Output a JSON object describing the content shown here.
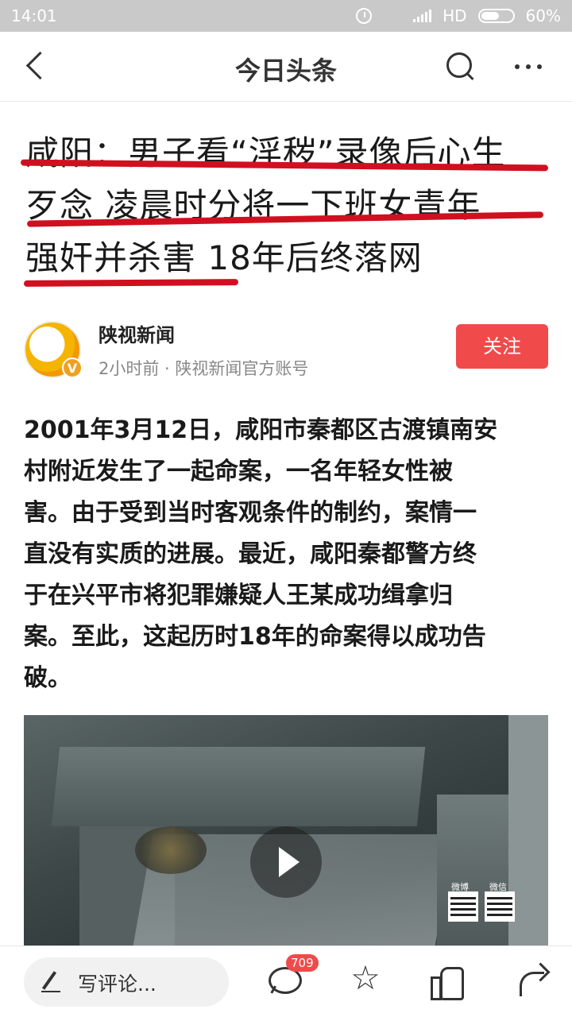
{
  "status_bar": {
    "time": "14:01",
    "network": "HD",
    "battery": "60%",
    "battery_level": 0.6,
    "icons": [
      "alarm-icon",
      "wifi-icon",
      "signal-icon",
      "battery-icon"
    ]
  },
  "header": {
    "title": "今日头条",
    "icons": [
      "back-arrow-icon",
      "search-icon",
      "more-dots-icon"
    ]
  },
  "article": {
    "headline_lines": [
      "咸阳：男子看“淫秽”录像后心生",
      "歹念 凌晨时分将一下班女青年",
      "强奸并杀害 18年后终落网"
    ],
    "author": {
      "name": "陕视新闻",
      "meta": "2小时前 · 陕视新闻官方账号",
      "verified_badge": "V",
      "follow_label": "关注",
      "accent_color": "#f04a4a"
    },
    "body_lines": [
      "2001年3月12日，咸阳市秦都区古渡镇南安",
      "村附近发生了一起命案，一名年轻女性被",
      "害。由于受到当时客观条件的制约，案情一",
      "直没有实质的进展。最近，咸阳秦都警方终",
      "于在兴平市将犯罪嫌疑人王某成功缉拿归",
      "案。至此，这起历时18年的命案得以成功告",
      "破。"
    ],
    "video": {
      "qr_labels": [
        "微博",
        "微信"
      ],
      "play_icon": "play-icon"
    }
  },
  "bottom_bar": {
    "comment_placeholder": "写评论...",
    "comment_count": "709",
    "icons": [
      "pen-icon",
      "comment-bubble-icon",
      "star-icon",
      "thumbs-up-icon",
      "share-icon"
    ]
  }
}
